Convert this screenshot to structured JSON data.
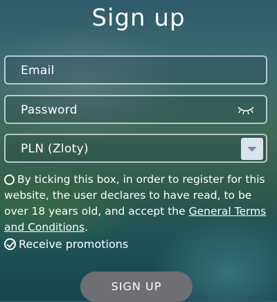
{
  "form": {
    "title": "Sign up",
    "email_placeholder": "Email",
    "password_placeholder": "Password",
    "currency_selected": "PLN (Zloty)",
    "consent_text": "By ticking this box, in order to register for this website, the user declares to have read, to be over 18 years old, and accept the ",
    "terms_link": "General Terms and Conditions",
    "consent_end": ".",
    "consent_checked": false,
    "promotions_label": "Receive promotions",
    "promotions_checked": true,
    "submit_label": "SIGN UP"
  },
  "icons": {
    "password_toggle": "eye-closed-icon",
    "select_arrow": "chevron-down-icon"
  }
}
